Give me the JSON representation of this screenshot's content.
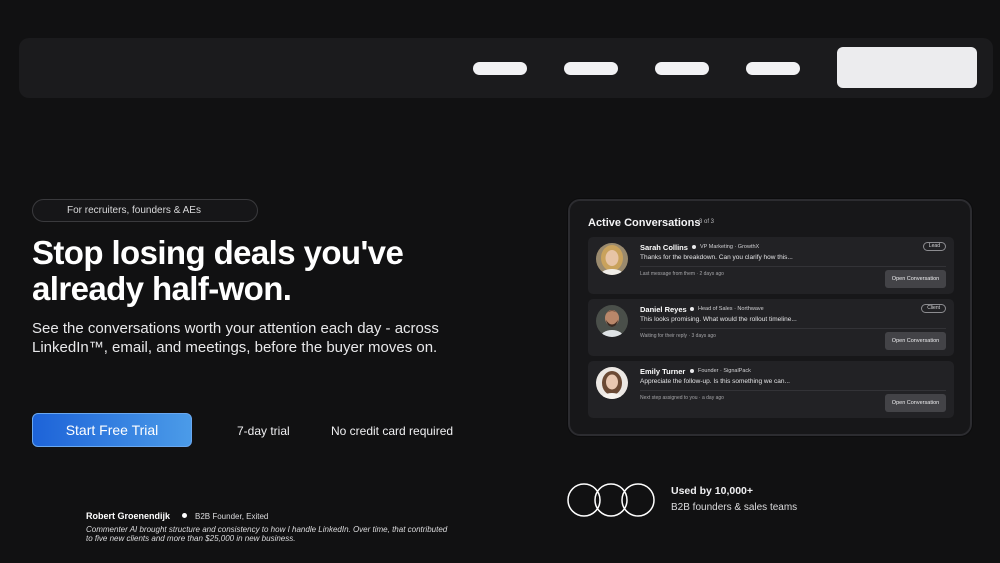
{
  "hero": {
    "tag": "For recruiters, founders & AEs",
    "headline_line1": "Stop losing deals you've",
    "headline_line2": "already half-won.",
    "subhead": "See the conversations worth your attention each day - across LinkedIn™, email, and meetings, before the buyer moves on.",
    "cta_label": "Start Free Trial",
    "note_trial": "7-day trial",
    "note_card": "No credit card required"
  },
  "testimonial": {
    "name": "Robert Groenendijk",
    "role": "B2B Founder, Exited",
    "quote": "Commenter AI brought structure and consistency to how I handle LinkedIn. Over time, that contributed to five new clients and more than $25,000 in new business."
  },
  "panel": {
    "title": "Active Conversations",
    "count": "3 of 3",
    "conversations": [
      {
        "name": "Sarah Collins",
        "role": "VP Marketing · GrowthX",
        "message": "Thanks for the breakdown. Can you clarify how this...",
        "meta": "Last message from them · 2 days ago",
        "badge": "Lead",
        "button": "Open Conversation"
      },
      {
        "name": "Daniel Reyes",
        "role": "Head of Sales · Northwave",
        "message": "This looks promising. What would the rollout timeline...",
        "meta": "Waiting for their reply · 3 days ago",
        "badge": "Client",
        "button": "Open Conversation"
      },
      {
        "name": "Emily Turner",
        "role": "Founder · SignalPack",
        "message": "Appreciate the follow-up. Is this something we can...",
        "meta": "Next step assigned to you · a day ago",
        "badge": "",
        "button": "Open Conversation"
      }
    ]
  },
  "social_proof": {
    "headline": "Used by 10,000+",
    "sub": "B2B founders & sales teams"
  },
  "colors": {
    "background": "#111112",
    "accent_start": "#1d63d8",
    "accent_end": "#4b9be8"
  }
}
